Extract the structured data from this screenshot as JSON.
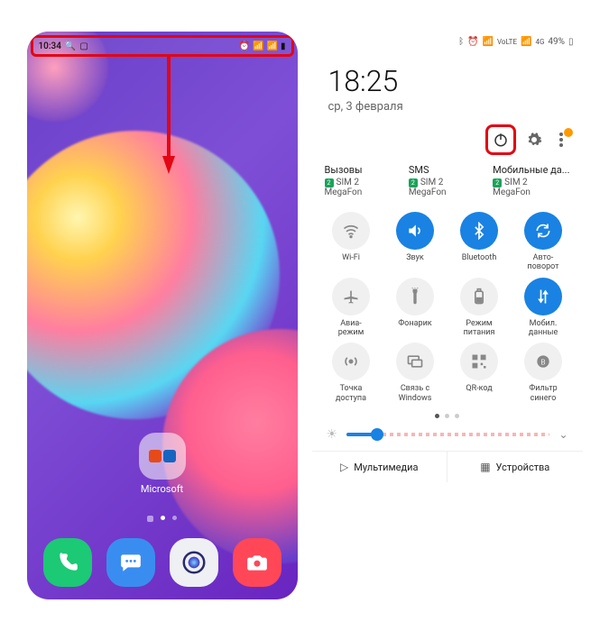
{
  "left": {
    "status_time": "10:34",
    "folder_label": "Microsoft"
  },
  "right": {
    "status": {
      "battery": "49%"
    },
    "clock": {
      "time": "18:25",
      "date": "ср, 3 февраля"
    },
    "sim": {
      "cards": [
        {
          "title": "Вызовы",
          "chip": "2",
          "sim": "SIM 2",
          "carrier": "MegaFon"
        },
        {
          "title": "SMS",
          "chip": "2",
          "sim": "SIM 2",
          "carrier": "MegaFon"
        },
        {
          "title": "Мобильные да...",
          "chip": "2",
          "sim": "SIM 2",
          "carrier": "MegaFon"
        }
      ]
    },
    "qs": [
      {
        "label": "Wi-Fi",
        "on": false,
        "icon": "wifi"
      },
      {
        "label": "Звук",
        "on": true,
        "icon": "sound"
      },
      {
        "label": "Bluetooth",
        "on": true,
        "icon": "bt"
      },
      {
        "label": "Авто-\nповорот",
        "on": true,
        "icon": "rotate"
      },
      {
        "label": "Авиа-\nрежим",
        "on": false,
        "icon": "plane"
      },
      {
        "label": "Фонарик",
        "on": false,
        "icon": "torch"
      },
      {
        "label": "Режим\nпитания",
        "on": false,
        "icon": "battery"
      },
      {
        "label": "Мобил.\nданные",
        "on": true,
        "icon": "data"
      },
      {
        "label": "Точка\nдоступа",
        "on": false,
        "icon": "hotspot"
      },
      {
        "label": "Связь с\nWindows",
        "on": false,
        "icon": "windows"
      },
      {
        "label": "QR-код",
        "on": false,
        "icon": "qr"
      },
      {
        "label": "Фильтр\nсинего",
        "on": false,
        "icon": "blue"
      }
    ],
    "bottom": {
      "media": "Мультимедиа",
      "devices": "Устройства"
    }
  }
}
